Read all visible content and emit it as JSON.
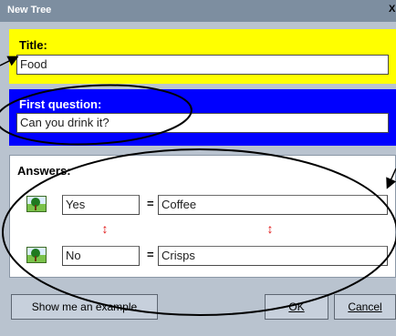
{
  "window": {
    "title": "New Tree",
    "close_label": "X"
  },
  "title_section": {
    "label": "Title:",
    "value": "Food"
  },
  "question_section": {
    "label": "First question:",
    "value": "Can you drink it?"
  },
  "answers_section": {
    "label": "Answers:",
    "rows": [
      {
        "answer": "Yes",
        "equals": "=",
        "result": "Coffee"
      },
      {
        "answer": "No",
        "equals": "=",
        "result": "Crisps"
      }
    ]
  },
  "buttons": {
    "example": "Show me an example",
    "ok": "OK",
    "cancel": "Cancel"
  },
  "colors": {
    "title_panel": "#ffff00",
    "question_panel": "#0000ff",
    "swap_arrows": "#e01515"
  },
  "icons": [
    "tree-picture-icon",
    "swap-arrow-icon"
  ]
}
